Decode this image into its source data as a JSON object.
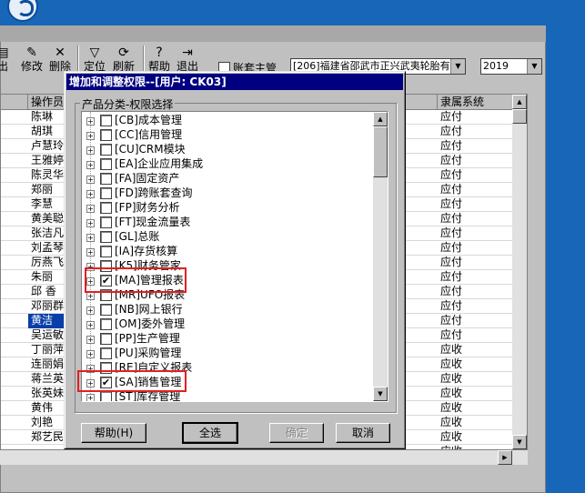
{
  "toolbar": {
    "buttons": [
      {
        "icon": "print-icon",
        "label": "出"
      },
      {
        "icon": "edit-icon",
        "label": "修改"
      },
      {
        "icon": "delete-icon",
        "label": "删除"
      },
      {
        "icon": "filter-icon",
        "label": "定位"
      },
      {
        "icon": "refresh-icon",
        "label": "刷新"
      },
      {
        "icon": "help-icon",
        "label": "帮助"
      },
      {
        "icon": "exit-icon",
        "label": "退出"
      }
    ],
    "account_checkbox_label": "账套主管",
    "account_select": "[206]福建省邵武市正兴武夷轮胎有",
    "year_select": "2019"
  },
  "grid": {
    "columns": [
      "操作员",
      "隶属系统"
    ],
    "rows": [
      {
        "operator": "陈琳",
        "system": "应付"
      },
      {
        "operator": "胡琪",
        "system": "应付"
      },
      {
        "operator": "卢慧玲",
        "system": "应付"
      },
      {
        "operator": "王雅婷",
        "system": "应付"
      },
      {
        "operator": "陈灵华",
        "system": "应付"
      },
      {
        "operator": "郑丽",
        "system": "应付"
      },
      {
        "operator": "李慧",
        "system": "应付"
      },
      {
        "operator": "黄美聪",
        "system": "应付"
      },
      {
        "operator": "张洁凡",
        "system": "应付"
      },
      {
        "operator": "刘孟琴",
        "system": "应付"
      },
      {
        "operator": "厉燕飞",
        "system": "应付"
      },
      {
        "operator": "朱丽",
        "system": "应付"
      },
      {
        "operator": "邱 香",
        "system": "应付"
      },
      {
        "operator": "邓丽群",
        "system": "应付"
      },
      {
        "operator": "黄洁",
        "system": "应付"
      },
      {
        "operator": "吴运敏",
        "system": "应付"
      },
      {
        "operator": "丁丽萍",
        "system": "应收"
      },
      {
        "operator": "连丽娟",
        "system": "应收"
      },
      {
        "operator": "蒋兰英",
        "system": "应收"
      },
      {
        "operator": "张英妹",
        "system": "应收"
      },
      {
        "operator": "黄伟",
        "system": "应收"
      },
      {
        "operator": "刘艳",
        "system": "应收"
      },
      {
        "operator": "郑艺民",
        "system": "应收"
      },
      {
        "operator": "",
        "system": "应收"
      }
    ]
  },
  "dialog": {
    "title": "增加和调整权限--[用户: CK03]",
    "group_label": "产品分类-权限选择",
    "tree": [
      {
        "label": "[CB]成本管理",
        "checked": false
      },
      {
        "label": "[CC]信用管理",
        "checked": false
      },
      {
        "label": "[CU]CRM模块",
        "checked": false
      },
      {
        "label": "[EA]企业应用集成",
        "checked": false
      },
      {
        "label": "[FA]固定资产",
        "checked": false
      },
      {
        "label": "[FD]跨账套查询",
        "checked": false
      },
      {
        "label": "[FP]财务分析",
        "checked": false
      },
      {
        "label": "[FT]现金流量表",
        "checked": false
      },
      {
        "label": "[GL]总账",
        "checked": false
      },
      {
        "label": "[IA]存货核算",
        "checked": false
      },
      {
        "label": "[K5]财务管家",
        "checked": false
      },
      {
        "label": "[MA]管理报表",
        "checked": true
      },
      {
        "label": "[MR]UFO报表",
        "checked": false
      },
      {
        "label": "[NB]网上银行",
        "checked": false
      },
      {
        "label": "[OM]委外管理",
        "checked": false
      },
      {
        "label": "[PP]生产管理",
        "checked": false
      },
      {
        "label": "[PU]采购管理",
        "checked": false
      },
      {
        "label": "[RE]自定义报表",
        "checked": false
      },
      {
        "label": "[SA]销售管理",
        "checked": true
      },
      {
        "label": "[ST]库存管理",
        "checked": false
      }
    ],
    "buttons": {
      "help": "帮助(H)",
      "select_all": "全选",
      "ok": "确定",
      "cancel": "取消"
    },
    "check_mark": "✔"
  },
  "colors": {
    "title_bar": "#000080",
    "highlight": "#e02020",
    "app_blue": "#1866b8"
  }
}
